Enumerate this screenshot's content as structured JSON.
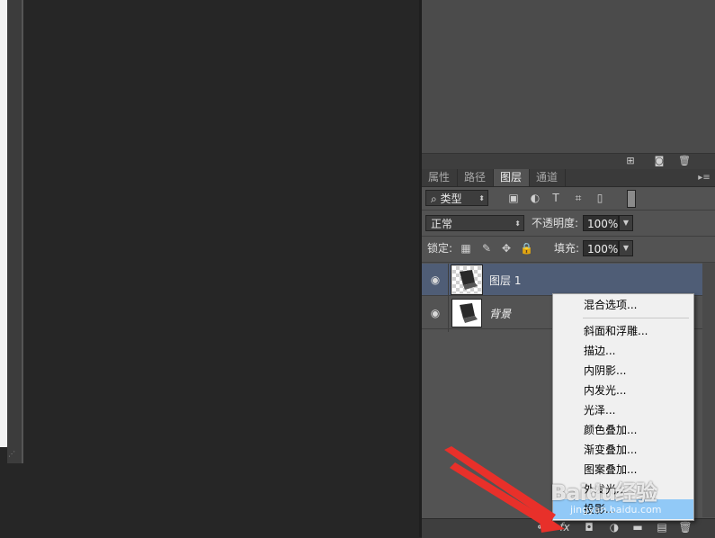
{
  "layers_panel": {
    "tabs": [
      {
        "label": "属性",
        "active": false
      },
      {
        "label": "路径",
        "active": false
      },
      {
        "label": "图层",
        "active": true
      },
      {
        "label": "通道",
        "active": false
      }
    ],
    "filter_kind": "类型",
    "blend_mode": "正常",
    "opacity_label": "不透明度:",
    "opacity_value": "100%",
    "lock_label": "锁定:",
    "fill_label": "填充:",
    "fill_value": "100%",
    "layers": [
      {
        "name": "图层 1",
        "selected": true,
        "visible": true
      },
      {
        "name": "背景",
        "selected": false,
        "visible": true
      }
    ]
  },
  "fx_menu": {
    "items": [
      {
        "label": "混合选项...",
        "highlighted": false
      },
      {
        "label": "斜面和浮雕...",
        "highlighted": false
      },
      {
        "label": "描边...",
        "highlighted": false
      },
      {
        "label": "内阴影...",
        "highlighted": false
      },
      {
        "label": "内发光...",
        "highlighted": false
      },
      {
        "label": "光泽...",
        "highlighted": false
      },
      {
        "label": "颜色叠加...",
        "highlighted": false
      },
      {
        "label": "渐变叠加...",
        "highlighted": false
      },
      {
        "label": "图案叠加...",
        "highlighted": false
      },
      {
        "label": "外发光...",
        "highlighted": false
      },
      {
        "label": "投影...",
        "highlighted": true
      }
    ]
  },
  "watermark": {
    "logo": "Baidu经验",
    "url": "jingyan.baidu.com"
  },
  "colors": {
    "selection": "#4f5d76",
    "menu_highlight": "#91c9f7",
    "arrow": "#e8302a"
  }
}
